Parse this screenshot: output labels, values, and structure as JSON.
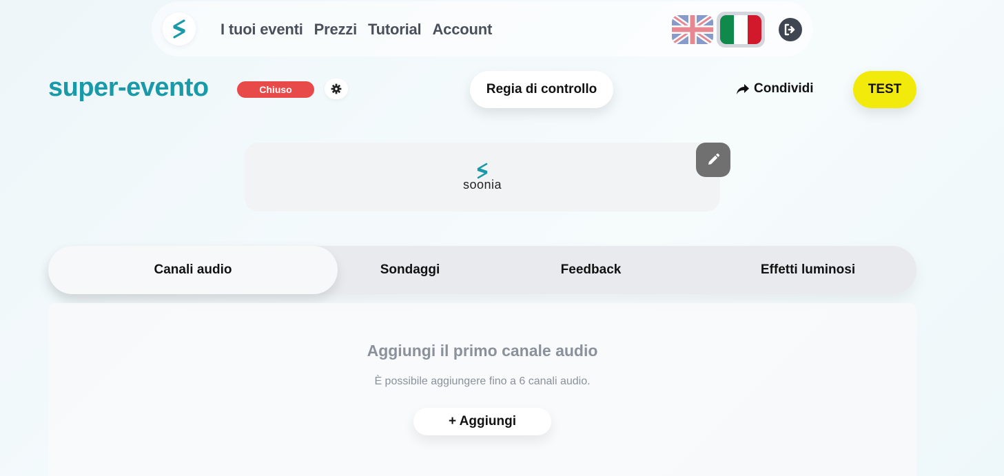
{
  "nav": {
    "links": [
      "I tuoi eventi",
      "Prezzi",
      "Tutorial",
      "Account"
    ],
    "languages": {
      "english": "flag-uk-icon",
      "italian": "flag-it-icon",
      "selected": "italian"
    },
    "logout_icon": "logout-icon"
  },
  "event": {
    "title": "super-evento",
    "status": "Chiuso",
    "settings_icon": "gear-icon"
  },
  "actions": {
    "regia": "Regia di controllo",
    "share": "Condividi",
    "test": "TEST"
  },
  "banner": {
    "logo_text": "soonia",
    "edit_icon": "pencil-icon"
  },
  "tabs": {
    "items": [
      "Canali audio",
      "Sondaggi",
      "Feedback",
      "Effetti luminosi"
    ],
    "active": "Canali audio"
  },
  "empty_state": {
    "title": "Aggiungi il primo canale audio",
    "subtitle": "È possibile aggiungere fino a 6 canali audio.",
    "add_button": "+ Aggiungi"
  },
  "colors": {
    "brand": "#1a9aa8",
    "status_closed": "#e84a4a",
    "test_yellow": "#f2ea0a"
  }
}
